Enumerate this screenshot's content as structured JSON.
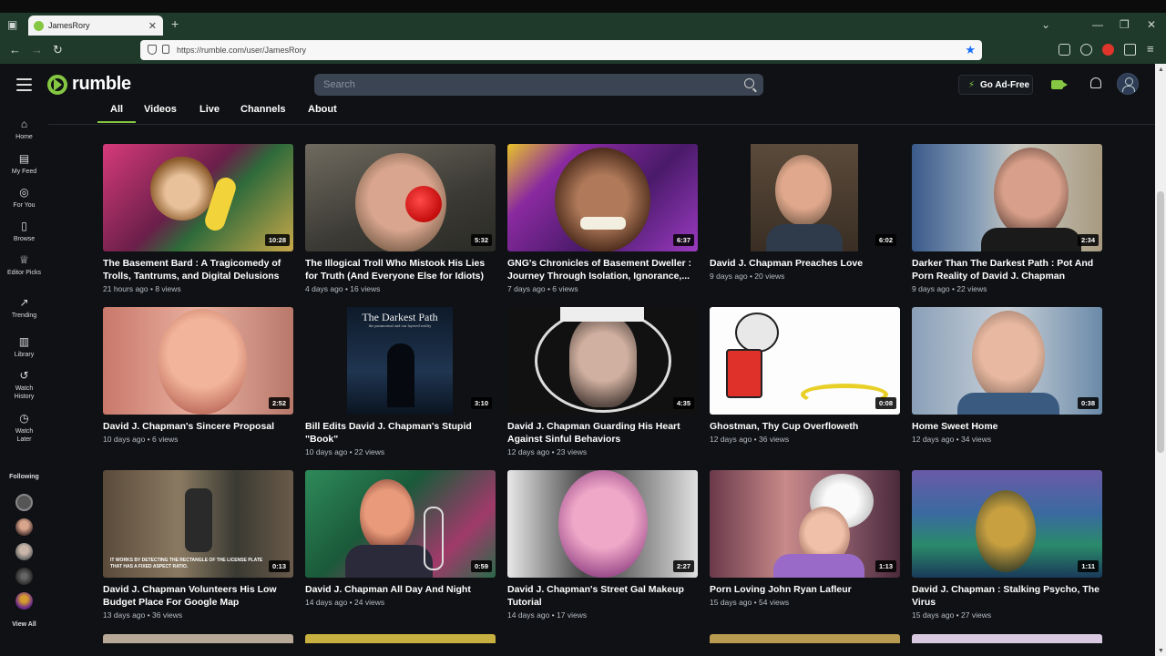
{
  "browser": {
    "tab_title": "JamesRory",
    "url": "https://rumble.com/user/JamesRory",
    "new_tab": "+"
  },
  "header": {
    "logo": "rumble",
    "search_placeholder": "Search",
    "ad_free": "Go Ad-Free"
  },
  "sidebar": {
    "items": [
      {
        "label": "Home",
        "icon": "home-icon"
      },
      {
        "label": "My Feed",
        "icon": "feed-icon"
      },
      {
        "label": "For You",
        "icon": "target-icon"
      },
      {
        "label": "Browse",
        "icon": "browse-icon"
      },
      {
        "label": "Editor Picks",
        "icon": "editor-picks-icon"
      },
      {
        "label": "Trending",
        "icon": "trending-icon"
      },
      {
        "label": "Library",
        "icon": "library-icon"
      },
      {
        "label": "Watch History",
        "icon": "history-icon"
      },
      {
        "label": "Watch Later",
        "icon": "clock-icon"
      }
    ],
    "following": "Following",
    "view_all": "View All"
  },
  "channel_tabs": [
    "All",
    "Videos",
    "Live",
    "Channels",
    "About"
  ],
  "accent": "#85c742",
  "videos": [
    {
      "title": "The Basement Bard : A Tragicomedy of Trolls, Tantrums, and Digital Delusions",
      "meta": "21 hours ago • 8 views",
      "duration": "10:28"
    },
    {
      "title": "The Illogical Troll Who Mistook His Lies for Truth (And Everyone Else for Idiots)",
      "meta": "4 days ago • 16 views",
      "duration": "5:32"
    },
    {
      "title": "GNG's Chronicles of Basement Dweller : Journey Through Isolation, Ignorance,...",
      "meta": "7 days ago • 6 views",
      "duration": "6:37"
    },
    {
      "title": "David J. Chapman Preaches Love",
      "meta": "9 days ago • 20 views",
      "duration": "6:02"
    },
    {
      "title": "Darker Than The Darkest Path : Pot And Porn Reality of David J. Chapman",
      "meta": "9 days ago • 22 views",
      "duration": "2:34"
    },
    {
      "title": "David J. Chapman's Sincere Proposal",
      "meta": "10 days ago • 6 views",
      "duration": "2:52"
    },
    {
      "title": "Bill Edits David J. Chapman's Stupid \"Book\"",
      "meta": "10 days ago • 22 views",
      "duration": "3:10"
    },
    {
      "title": "David J. Chapman Guarding His Heart Against Sinful Behaviors",
      "meta": "12 days ago • 23 views",
      "duration": "4:35"
    },
    {
      "title": "Ghostman, Thy Cup Overfloweth",
      "meta": "12 days ago • 36 views",
      "duration": "0:08"
    },
    {
      "title": "Home Sweet Home",
      "meta": "12 days ago • 34 views",
      "duration": "0:38"
    },
    {
      "title": "David J. Chapman Volunteers His Low Budget Place For Google Map",
      "meta": "13 days ago • 36 views",
      "duration": "0:13"
    },
    {
      "title": "David J. Chapman All Day And Night",
      "meta": "14 days ago • 24 views",
      "duration": "0:59"
    },
    {
      "title": "David J. Chapman's Street Gal Makeup Tutorial",
      "meta": "14 days ago • 17 views",
      "duration": "2:27"
    },
    {
      "title": "Porn Loving John Ryan Lafleur",
      "meta": "15 days ago • 54 views",
      "duration": "1:13"
    },
    {
      "title": "David J. Chapman : Stalking Psycho, The Virus",
      "meta": "15 days ago • 27 views",
      "duration": "1:11"
    }
  ],
  "thumb_text": {
    "book_title": "The Darkest Path",
    "book_subtitle": "the paranormal and our layered reality",
    "map_caption": "IT WORKS BY DETECTING THE RECTANGLE OF THE LICENSE PLATE THAT HAS A FIXED ASPECT RATIO."
  }
}
